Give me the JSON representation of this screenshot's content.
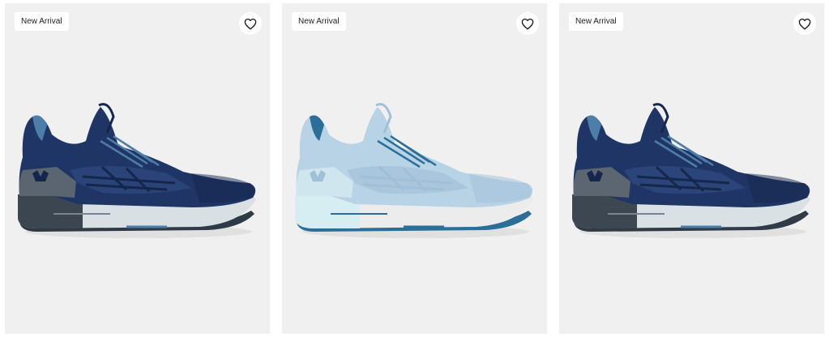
{
  "products": [
    {
      "badge": "New Arrival",
      "icon": "heart-outline-icon",
      "colors": {
        "upper": "#1e3566",
        "upper_dark": "#15264b",
        "overlay": "#2a447a",
        "heel": "#5a6570",
        "midsole_side": "#3c4650",
        "midsole": "#d8e0e4",
        "accent": "#4d7ea8",
        "outsole": "#2e3a45"
      }
    },
    {
      "badge": "New Arrival",
      "icon": "heart-outline-icon",
      "colors": {
        "upper": "#b8d3e6",
        "upper_dark": "#9fc0d8",
        "overlay": "#aac6dc",
        "heel": "#cfe6ee",
        "midsole_side": "#d6eef2",
        "midsole": "#ececec",
        "accent": "#2b6f99",
        "outsole": "#2b6f99"
      }
    },
    {
      "badge": "New Arrival",
      "icon": "heart-outline-icon",
      "colors": {
        "upper": "#1f3565",
        "upper_dark": "#16274c",
        "overlay": "#2b457b",
        "heel": "#5c6670",
        "midsole_side": "#3d4751",
        "midsole": "#d9e1e5",
        "accent": "#4d7ea8",
        "outsole": "#2f3b46"
      }
    }
  ]
}
